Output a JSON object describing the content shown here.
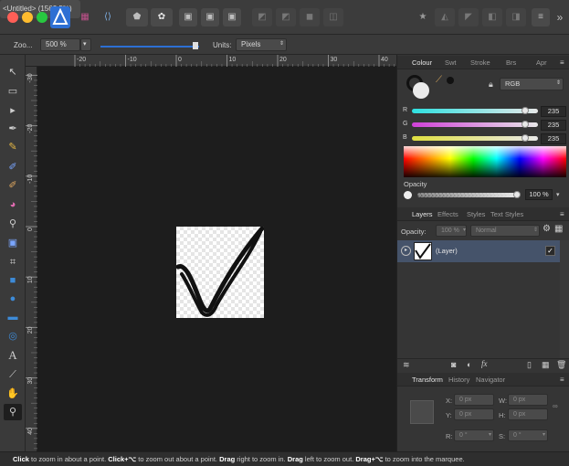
{
  "window": {
    "title": "<Untitled> (1562.5%)"
  },
  "toolbar": {
    "zoom_label": "Zoo...",
    "zoom_value": "500 %",
    "units_label": "Units:",
    "units_value": "Pixels"
  },
  "ruler": {
    "unit": "px",
    "h_ticks": [
      "-20",
      "-10",
      "0",
      "10",
      "20",
      "30",
      "40"
    ],
    "v_ticks": [
      "-30",
      "-20",
      "-10",
      "0",
      "10",
      "20",
      "30",
      "40"
    ]
  },
  "colour_panel": {
    "tabs": [
      "Colour",
      "Swt",
      "Stroke",
      "Brs",
      "Apr"
    ],
    "active_tab": "Colour",
    "model": "RGB",
    "channels": [
      {
        "label": "R",
        "value": "235",
        "fraction": 0.92
      },
      {
        "label": "G",
        "value": "235",
        "fraction": 0.92
      },
      {
        "label": "B",
        "value": "235",
        "fraction": 0.92
      }
    ],
    "opacity_label": "Opacity",
    "opacity_value": "100 %"
  },
  "layers_panel": {
    "tabs": [
      "Layers",
      "Effects",
      "Styles",
      "Text Styles"
    ],
    "active_tab": "Layers",
    "opacity_label": "Opacity:",
    "opacity_value": "100 %",
    "blend_mode": "Normal",
    "layers": [
      {
        "name": "(Layer)",
        "visible": true
      }
    ]
  },
  "transform_panel": {
    "tabs": [
      "Transform",
      "History",
      "Navigator"
    ],
    "active_tab": "Transform",
    "fields": {
      "x_label": "X:",
      "x": "0 px",
      "y_label": "Y:",
      "y": "0 px",
      "w_label": "W:",
      "w": "0 px",
      "h_label": "H:",
      "h": "0 px",
      "r_label": "R:",
      "r": "0 °",
      "s_label": "S:",
      "s": "0 °"
    }
  },
  "status": {
    "s1": "Click",
    "t1": " to zoom in about a point. ",
    "s2": "Click+⌥",
    "t2": " to zoom out about a point. ",
    "s3": "Drag",
    "t3": " right to zoom in. ",
    "s4": "Drag",
    "t4": " left to zoom out. ",
    "s5": "Drag+⌥",
    "t5": " to zoom into the marquee."
  }
}
